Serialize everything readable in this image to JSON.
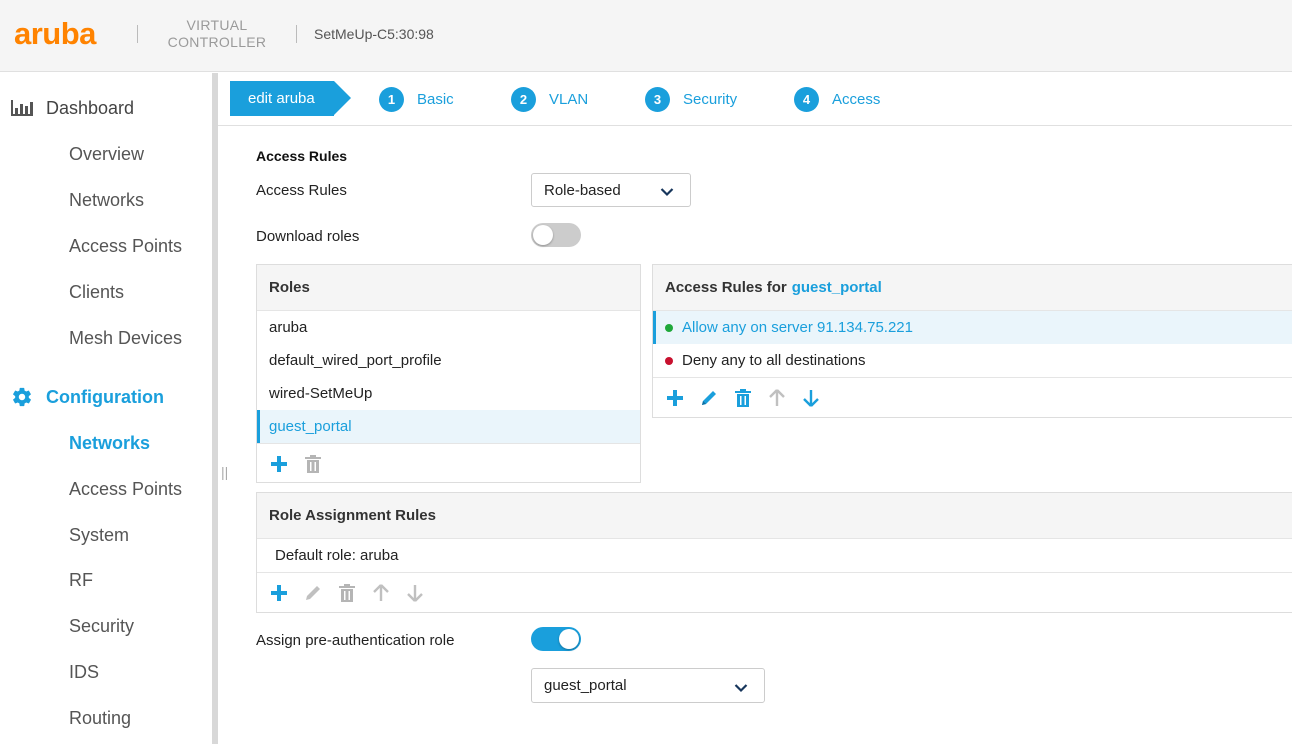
{
  "header": {
    "logo": "aruba",
    "product_line1": "VIRTUAL",
    "product_line2": "CONTROLLER",
    "device_name": "SetMeUp-C5:30:98"
  },
  "sidebar": {
    "dashboard": {
      "label": "Dashboard",
      "icon": "bar-chart-icon",
      "items": [
        "Overview",
        "Networks",
        "Access Points",
        "Clients",
        "Mesh Devices"
      ]
    },
    "configuration": {
      "label": "Configuration",
      "icon": "gear-icon",
      "items": [
        "Networks",
        "Access Points",
        "System",
        "RF",
        "Security",
        "IDS",
        "Routing"
      ],
      "active_item": "Networks"
    }
  },
  "wizard": {
    "edit_label": "edit aruba",
    "steps": [
      {
        "num": "1",
        "label": "Basic"
      },
      {
        "num": "2",
        "label": "VLAN"
      },
      {
        "num": "3",
        "label": "Security"
      },
      {
        "num": "4",
        "label": "Access"
      }
    ]
  },
  "access": {
    "section_title": "Access Rules",
    "access_rules_label": "Access Rules",
    "access_rules_value": "Role-based",
    "download_roles_label": "Download roles",
    "download_roles_on": false
  },
  "roles_panel": {
    "title": "Roles",
    "roles": [
      "aruba",
      "default_wired_port_profile",
      "wired-SetMeUp",
      "guest_portal"
    ],
    "selected": "guest_portal"
  },
  "rules_panel": {
    "title_prefix": "Access Rules for",
    "title_role": "guest_portal",
    "rules": [
      {
        "text": "Allow any on server 91.134.75.221",
        "status": "allow",
        "color": "#1fa83a"
      },
      {
        "text": "Deny any to all destinations",
        "status": "deny",
        "color": "#c8102e"
      }
    ]
  },
  "assignment_panel": {
    "title": "Role Assignment Rules",
    "default_role": "Default role: aruba"
  },
  "preauth": {
    "label": "Assign pre-authentication role",
    "enabled": true,
    "role_value": "guest_portal"
  },
  "colors": {
    "accent": "#1a9fdc",
    "brand": "#ff8300",
    "muted_icon": "#b5b5b5"
  }
}
